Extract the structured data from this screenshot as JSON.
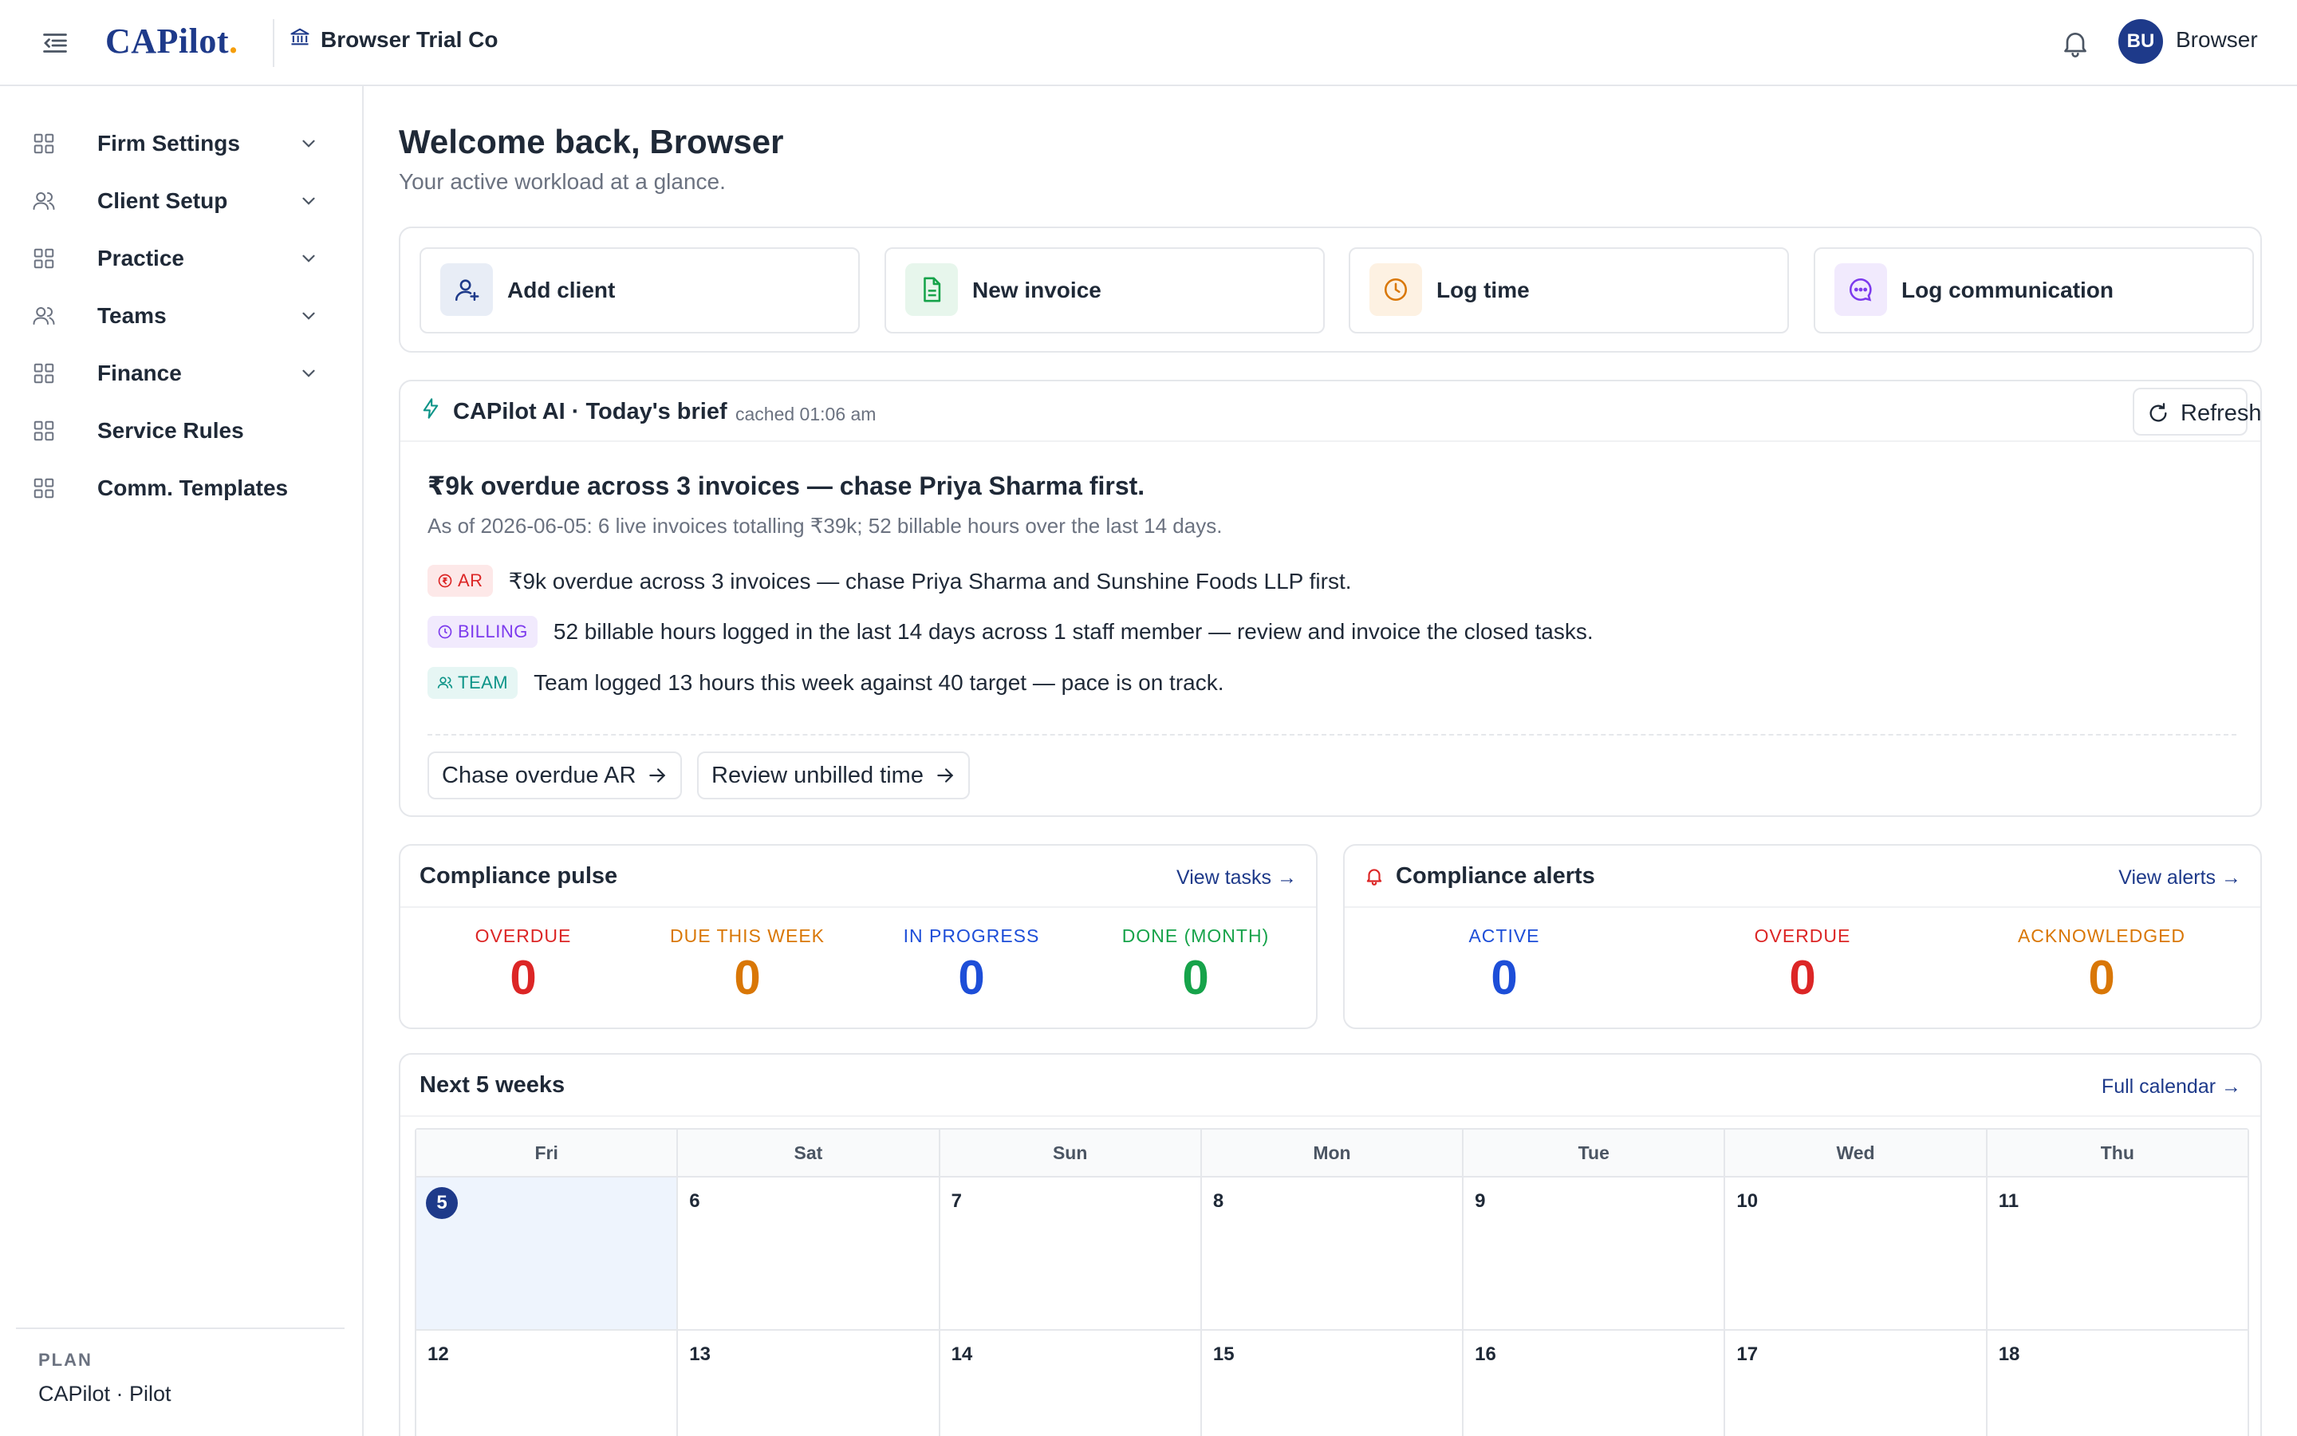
{
  "header": {
    "brand": "CAPilot",
    "brand_dot": ".",
    "firm_name": "Browser Trial Co",
    "avatar_initials": "BU",
    "user_name": "Browser"
  },
  "sidebar": {
    "items": [
      {
        "label": "Firm Settings",
        "icon": "grid-icon",
        "expandable": true
      },
      {
        "label": "Client Setup",
        "icon": "users-icon",
        "expandable": true
      },
      {
        "label": "Practice",
        "icon": "grid-icon",
        "expandable": true
      },
      {
        "label": "Teams",
        "icon": "users-icon",
        "expandable": true
      },
      {
        "label": "Finance",
        "icon": "grid-icon",
        "expandable": true
      },
      {
        "label": "Service Rules",
        "icon": "grid-icon",
        "expandable": false
      },
      {
        "label": "Comm. Templates",
        "icon": "grid-icon",
        "expandable": false
      }
    ],
    "plan_label": "PLAN",
    "plan_value": "CAPilot · Pilot"
  },
  "main": {
    "welcome": "Welcome back, Browser",
    "subtitle": "Your active workload at a glance.",
    "quick_actions": [
      {
        "label": "Add client",
        "icon": "user-icon",
        "color": "#1e3a8a",
        "bg": "#e8edf6"
      },
      {
        "label": "New invoice",
        "icon": "document-icon",
        "color": "#16a34a",
        "bg": "#e7f6ec"
      },
      {
        "label": "Log time",
        "icon": "clock-icon",
        "color": "#d97706",
        "bg": "#fdf1e2"
      },
      {
        "label": "Log communication",
        "icon": "chat-icon",
        "color": "#7c3aed",
        "bg": "#f1eafd"
      }
    ]
  },
  "brief": {
    "title": "CAPilot AI · Today's brief",
    "cached": "cached 01:06 am",
    "refresh_label": "Refresh",
    "headline": "₹9k overdue across 3 invoices — chase Priya Sharma first.",
    "as_of": "As of 2026-06-05: 6 live invoices totalling ₹39k; 52 billable hours over the last 14 days.",
    "lines": [
      {
        "badge": "AR",
        "text": "₹9k overdue across 3 invoices — chase Priya Sharma and Sunshine Foods LLP first."
      },
      {
        "badge": "BILLING",
        "text": "52 billable hours logged in the last 14 days across 1 staff member — review and invoice the closed tasks."
      },
      {
        "badge": "TEAM",
        "text": "Team logged 13 hours this week against 40 target — pace is on track."
      }
    ],
    "actions": [
      "Chase overdue AR",
      "Review unbilled time"
    ]
  },
  "compliance_pulse": {
    "title": "Compliance pulse",
    "link": "View tasks →",
    "stats": [
      {
        "label": "OVERDUE",
        "value": "0",
        "color": "#dc2626"
      },
      {
        "label": "DUE THIS WEEK",
        "value": "0",
        "color": "#d97706"
      },
      {
        "label": "IN PROGRESS",
        "value": "0",
        "color": "#1d4ed8"
      },
      {
        "label": "DONE (MONTH)",
        "value": "0",
        "color": "#16a34a"
      }
    ]
  },
  "compliance_alerts": {
    "title": "Compliance alerts",
    "link": "View alerts →",
    "stats": [
      {
        "label": "ACTIVE",
        "value": "0",
        "color": "#1d4ed8"
      },
      {
        "label": "OVERDUE",
        "value": "0",
        "color": "#dc2626"
      },
      {
        "label": "ACKNOWLEDGED",
        "value": "0",
        "color": "#d97706"
      }
    ]
  },
  "calendar": {
    "title": "Next 5 weeks",
    "link": "Full calendar →",
    "days_of_week": [
      "Fri",
      "Sat",
      "Sun",
      "Mon",
      "Tue",
      "Wed",
      "Thu"
    ],
    "weeks": [
      [
        "5",
        "6",
        "7",
        "8",
        "9",
        "10",
        "11"
      ],
      [
        "12",
        "13",
        "14",
        "15",
        "16",
        "17",
        "18"
      ]
    ],
    "today": "5"
  }
}
